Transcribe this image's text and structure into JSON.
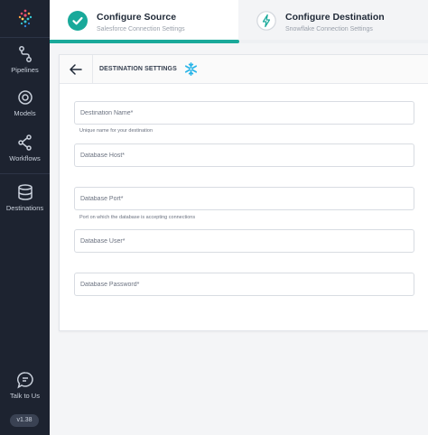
{
  "sidebar": {
    "items": [
      {
        "label": "Pipelines",
        "icon": "pipelines-icon"
      },
      {
        "label": "Models",
        "icon": "models-icon"
      },
      {
        "label": "Workflows",
        "icon": "workflows-icon"
      },
      {
        "label": "Destinations",
        "icon": "destinations-icon"
      }
    ],
    "talk_label": "Talk to Us",
    "version": "v1.38"
  },
  "steps": [
    {
      "title": "Configure Source",
      "subtitle": "Salesforce Connection Settings",
      "status": "complete"
    },
    {
      "title": "Configure Destination",
      "subtitle": "Snowflake Connection Settings",
      "status": "current"
    }
  ],
  "progress": 0.5,
  "card": {
    "title": "DESTINATION SETTINGS",
    "fields": [
      {
        "placeholder": "Destination Name*",
        "value": "",
        "help": "Unique name for your destination"
      },
      {
        "placeholder": "Database Host*",
        "value": "",
        "help": ""
      },
      {
        "placeholder": "Database Port*",
        "value": "",
        "help": "Port on which the database is accepting connections"
      },
      {
        "placeholder": "Database User*",
        "value": "",
        "help": ""
      },
      {
        "placeholder": "Database Password*",
        "value": "",
        "help": ""
      }
    ]
  },
  "colors": {
    "sidebar": "#1d2330",
    "accent": "#19a99a",
    "snowflake": "#29b5e8"
  }
}
